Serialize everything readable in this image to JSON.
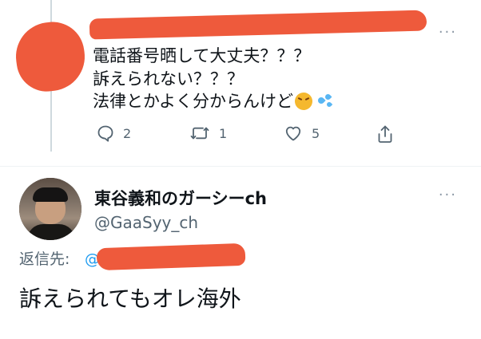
{
  "colors": {
    "redaction": "#ee5a3c",
    "text": "#0f1419",
    "muted": "#536471",
    "mention": "#1d9bf0"
  },
  "tweet": {
    "lines": [
      "電話番号晒して大丈夫？？？",
      "訴えられない？？？",
      "法律とかよく分からんけど"
    ],
    "emojis": [
      "confounded-face-emoji",
      "sweat-droplets-emoji"
    ],
    "actions": {
      "reply_icon": "reply-icon",
      "reply_count": "2",
      "retweet_icon": "retweet-icon",
      "retweet_count": "1",
      "like_icon": "heart-icon",
      "like_count": "5",
      "share_icon": "share-icon"
    },
    "more_icon": "more-options-icon"
  },
  "reply": {
    "display_name": "東谷義和のガーシーch",
    "handle": "@GaaSyy_ch",
    "reply_to_label": "返信先:",
    "reply_to_mention": "@",
    "text": "訴えられてもオレ海外",
    "more_icon": "more-options-icon"
  }
}
